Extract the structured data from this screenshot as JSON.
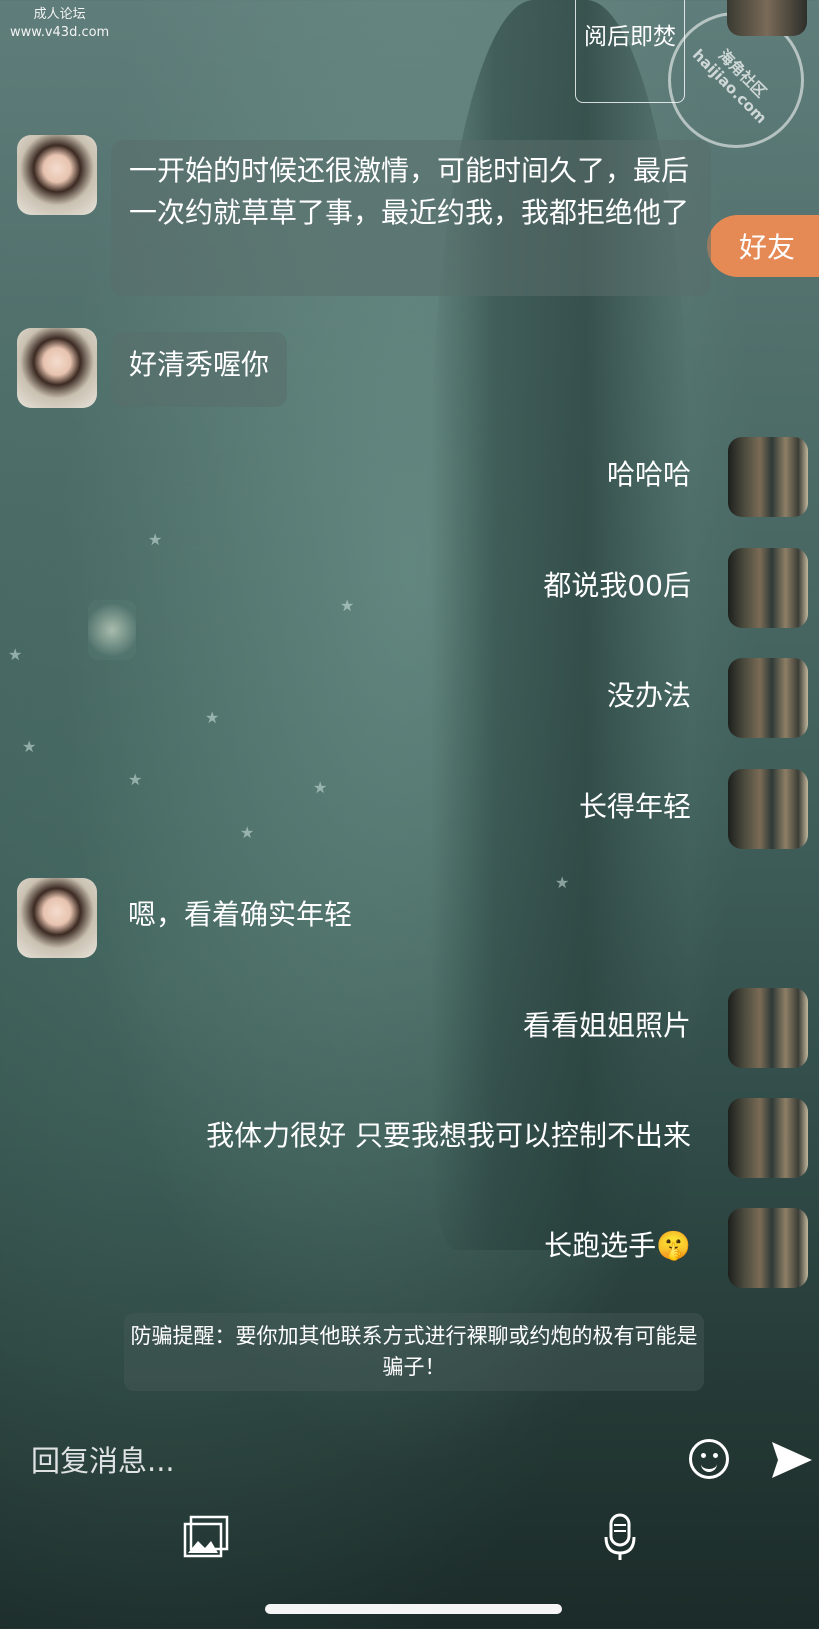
{
  "watermark": {
    "line1": "成人论坛",
    "line2": "www.v43d.com"
  },
  "stamp": {
    "line1": "海角社区",
    "line2": "haijiao.com"
  },
  "read_burn_label": "阅后即焚",
  "friend_tag": "好友",
  "messages": [
    {
      "side": "left",
      "text": "一开始的时候还很激情，可能时间久了，最后一次约就草草了事，最近约我，我都拒绝他了"
    },
    {
      "side": "left",
      "text": "好清秀喔你"
    },
    {
      "side": "right",
      "text": "哈哈哈"
    },
    {
      "side": "right",
      "text": "都说我00后"
    },
    {
      "side": "right",
      "text": "没办法"
    },
    {
      "side": "right",
      "text": "长得年轻"
    },
    {
      "side": "left",
      "text": "嗯，看着确实年轻"
    },
    {
      "side": "right",
      "text": "看看姐姐照片"
    },
    {
      "side": "right",
      "text": "我体力很好  只要我想我可以控制不出来"
    },
    {
      "side": "right",
      "text": "长跑选手🤫"
    }
  ],
  "warning": "防骗提醒：要你加其他联系方式进行裸聊或约炮的极有可能是骗子！",
  "input": {
    "placeholder": "回复消息..."
  },
  "icons": {
    "emoji": "smiley-face-icon",
    "send": "send-arrow-icon",
    "image": "image-gallery-icon",
    "voice": "microphone-icon"
  },
  "colors": {
    "friend_tag": "#e58a55",
    "bubble": "rgba(90,110,108,0.55)"
  }
}
